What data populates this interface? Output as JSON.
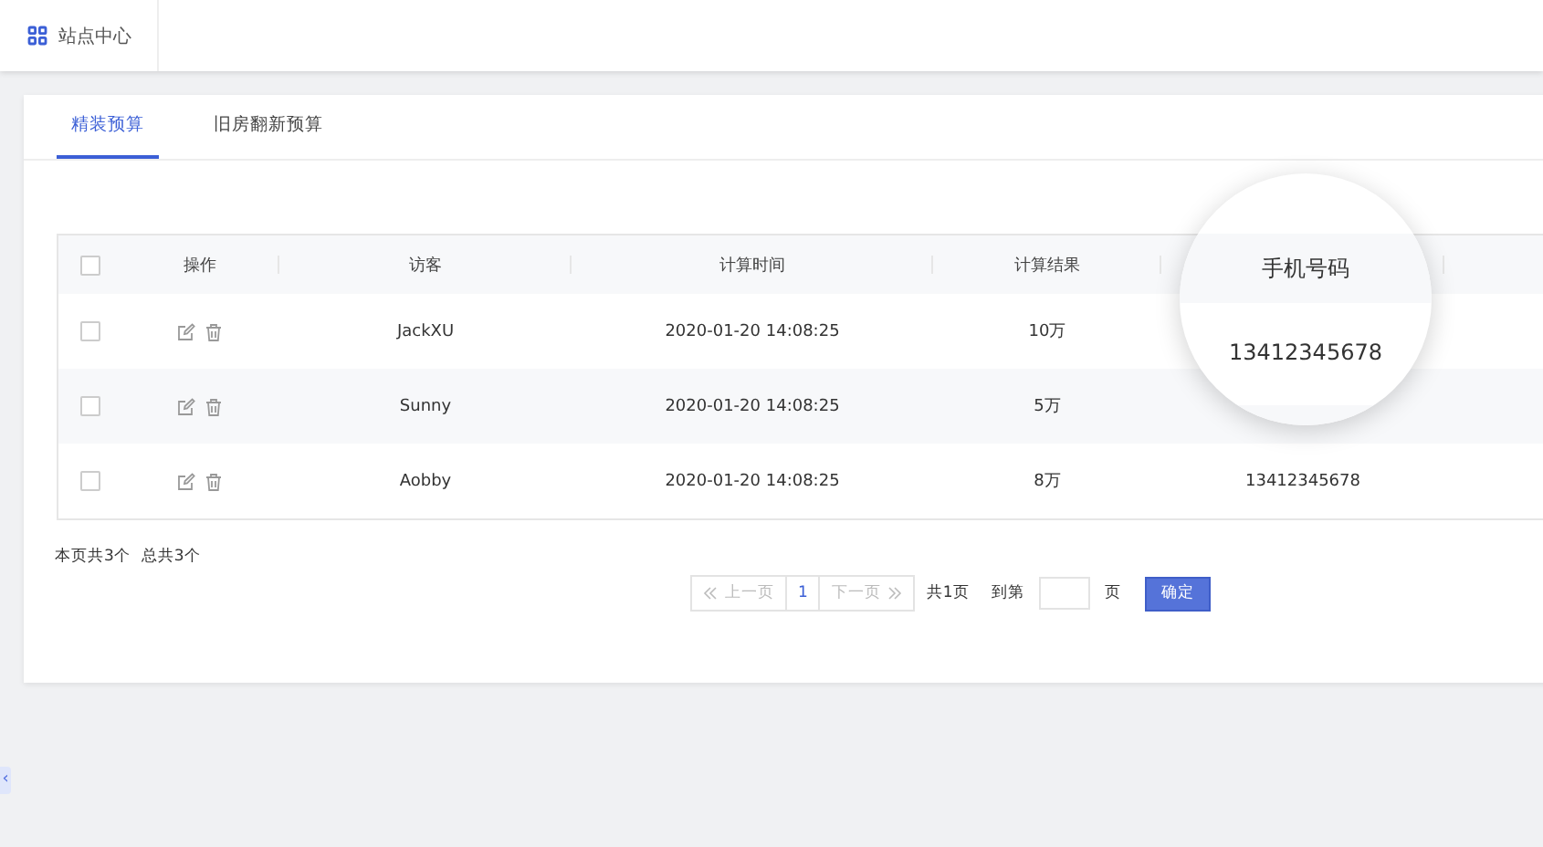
{
  "topbar": {
    "title": "站点中心"
  },
  "tabs": [
    {
      "label": "精装预算",
      "selected": true
    },
    {
      "label": "旧房翻新预算",
      "selected": false
    }
  ],
  "table": {
    "header_checked": false,
    "columns": [
      "操作",
      "访客",
      "计算时间",
      "计算结果"
    ],
    "rows": [
      {
        "checked": false,
        "visitor": "JackXU",
        "time": "2020-01-20 14:08:25",
        "result": "10万"
      },
      {
        "checked": false,
        "visitor": "Sunny",
        "time": "2020-01-20 14:08:25",
        "result": "5万"
      },
      {
        "checked": false,
        "visitor": "Aobby",
        "time": "2020-01-20 14:08:25",
        "result": "8万",
        "phone": "13412345678"
      }
    ]
  },
  "magnifier": {
    "header": "手机号码",
    "value": "13412345678"
  },
  "summary": {
    "page_count": "本页共3个",
    "total_count": "总共3个"
  },
  "pagination": {
    "prev": "上一页",
    "prev_disabled": true,
    "pages": [
      {
        "label": "1",
        "selected": true
      }
    ],
    "next": "下一页",
    "next_disabled": true,
    "total_pages": "共1页",
    "goto_label": "到第",
    "goto_unit": "页",
    "confirm": "确定"
  },
  "sidebar_toggle": "‹"
}
